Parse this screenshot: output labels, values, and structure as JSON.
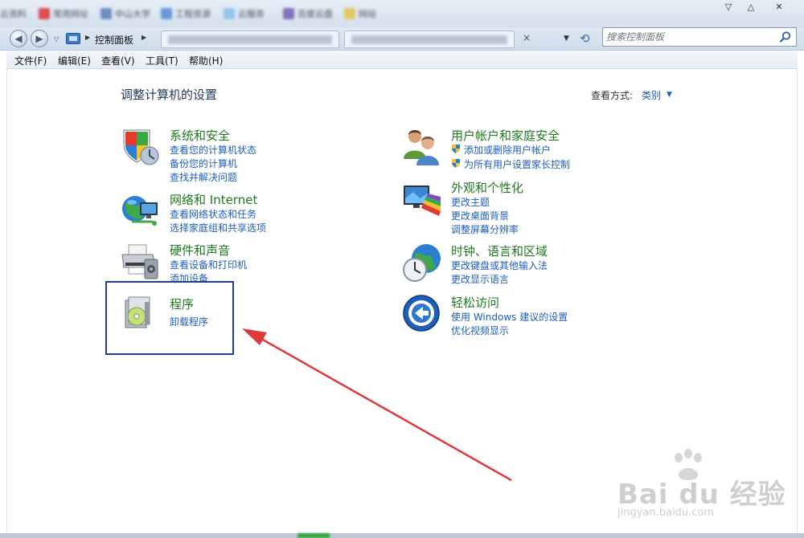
{
  "window": {
    "controls": [
      "▽",
      "△",
      "✕"
    ]
  },
  "nav": {
    "breadcrumb": "控制面板",
    "search_placeholder": "搜索控制面板"
  },
  "menu": [
    "文件(F)",
    "编辑(E)",
    "查看(V)",
    "工具(T)",
    "帮助(H)"
  ],
  "page": {
    "title": "调整计算机的设置",
    "view_by_label": "查看方式:",
    "view_by_value": "类别"
  },
  "categories": [
    {
      "title": "系统和安全",
      "icon": "shield-computer-icon",
      "links": [
        "查看您的计算机状态",
        "备份您的计算机",
        "查找并解决问题"
      ]
    },
    {
      "title": "网络和 Internet",
      "icon": "network-globe-icon",
      "links": [
        "查看网络状态和任务",
        "选择家庭组和共享选项"
      ]
    },
    {
      "title": "硬件和声音",
      "icon": "printer-speaker-icon",
      "links": [
        "查看设备和打印机",
        "添加设备"
      ]
    },
    {
      "title": "程序",
      "icon": "programs-disc-icon",
      "links": [
        "卸载程序"
      ]
    },
    {
      "title": "用户帐户和家庭安全",
      "icon": "users-icon",
      "links": [
        "添加或删除用户帐户",
        "为所有用户设置家长控制"
      ]
    },
    {
      "title": "外观和个性化",
      "icon": "monitor-palette-icon",
      "links": [
        "更改主题",
        "更改桌面背景",
        "调整屏幕分辨率"
      ]
    },
    {
      "title": "时钟、语言和区域",
      "icon": "clock-globe-icon",
      "links": [
        "更改键盘或其他输入法",
        "更改显示语言"
      ]
    },
    {
      "title": "轻松访问",
      "icon": "ease-of-access-icon",
      "links": [
        "使用 Windows 建议的设置",
        "优化视频显示"
      ]
    }
  ],
  "watermark": {
    "brand": "Bai du 经验",
    "url": "jingyan.baidu.com"
  },
  "colors": {
    "category_title": "#1f7a1f",
    "link": "#1e5ebf",
    "highlight_box": "#1f3f94",
    "arrow": "#e0393b"
  }
}
